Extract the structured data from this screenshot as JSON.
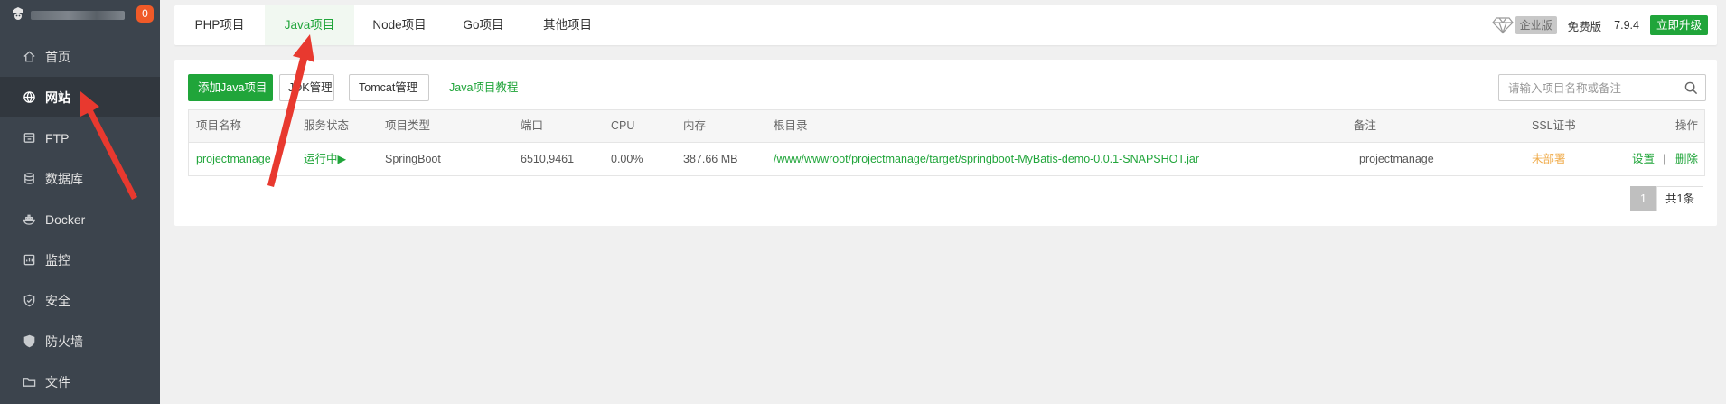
{
  "sidebar": {
    "badge": "0",
    "items": [
      {
        "label": "首页",
        "icon": "home-icon"
      },
      {
        "label": "网站",
        "icon": "globe-icon"
      },
      {
        "label": "FTP",
        "icon": "ftp-icon"
      },
      {
        "label": "数据库",
        "icon": "database-icon"
      },
      {
        "label": "Docker",
        "icon": "docker-icon"
      },
      {
        "label": "监控",
        "icon": "monitor-icon"
      },
      {
        "label": "安全",
        "icon": "shield-icon"
      },
      {
        "label": "防火墙",
        "icon": "firewall-icon"
      },
      {
        "label": "文件",
        "icon": "folder-icon"
      }
    ]
  },
  "tabs": [
    "PHP项目",
    "Java项目",
    "Node项目",
    "Go项目",
    "其他项目"
  ],
  "version": {
    "edition": "企业版",
    "free": "免费版",
    "number": "7.9.4",
    "upgrade": "立即升级"
  },
  "toolbar": {
    "add": "添加Java项目",
    "jdk": "JDK管理",
    "tomcat": "Tomcat管理",
    "tutorial": "Java项目教程",
    "search_placeholder": "请输入项目名称或备注"
  },
  "table": {
    "headers": [
      "项目名称",
      "服务状态",
      "项目类型",
      "端口",
      "CPU",
      "内存",
      "根目录",
      "备注",
      "SSL证书",
      "操作"
    ],
    "rows": [
      {
        "name": "projectmanage",
        "status": "运行中▶",
        "type": "SpringBoot",
        "port": "6510,9461",
        "cpu": "0.00%",
        "memory": "387.66 MB",
        "root": "/www/wwwroot/projectmanage/target/springboot-MyBatis-demo-0.0.1-SNAPSHOT.jar",
        "note": "projectmanage",
        "ssl": "未部署",
        "action_settings": "设置",
        "action_sep": "|",
        "action_delete": "删除"
      }
    ]
  },
  "pager": {
    "page": "1",
    "total": "共1条"
  },
  "colors": {
    "accent": "#20a53a",
    "sidebar": "#3c444d",
    "warning": "#f0ad4e",
    "annotation": "#e8392f"
  }
}
